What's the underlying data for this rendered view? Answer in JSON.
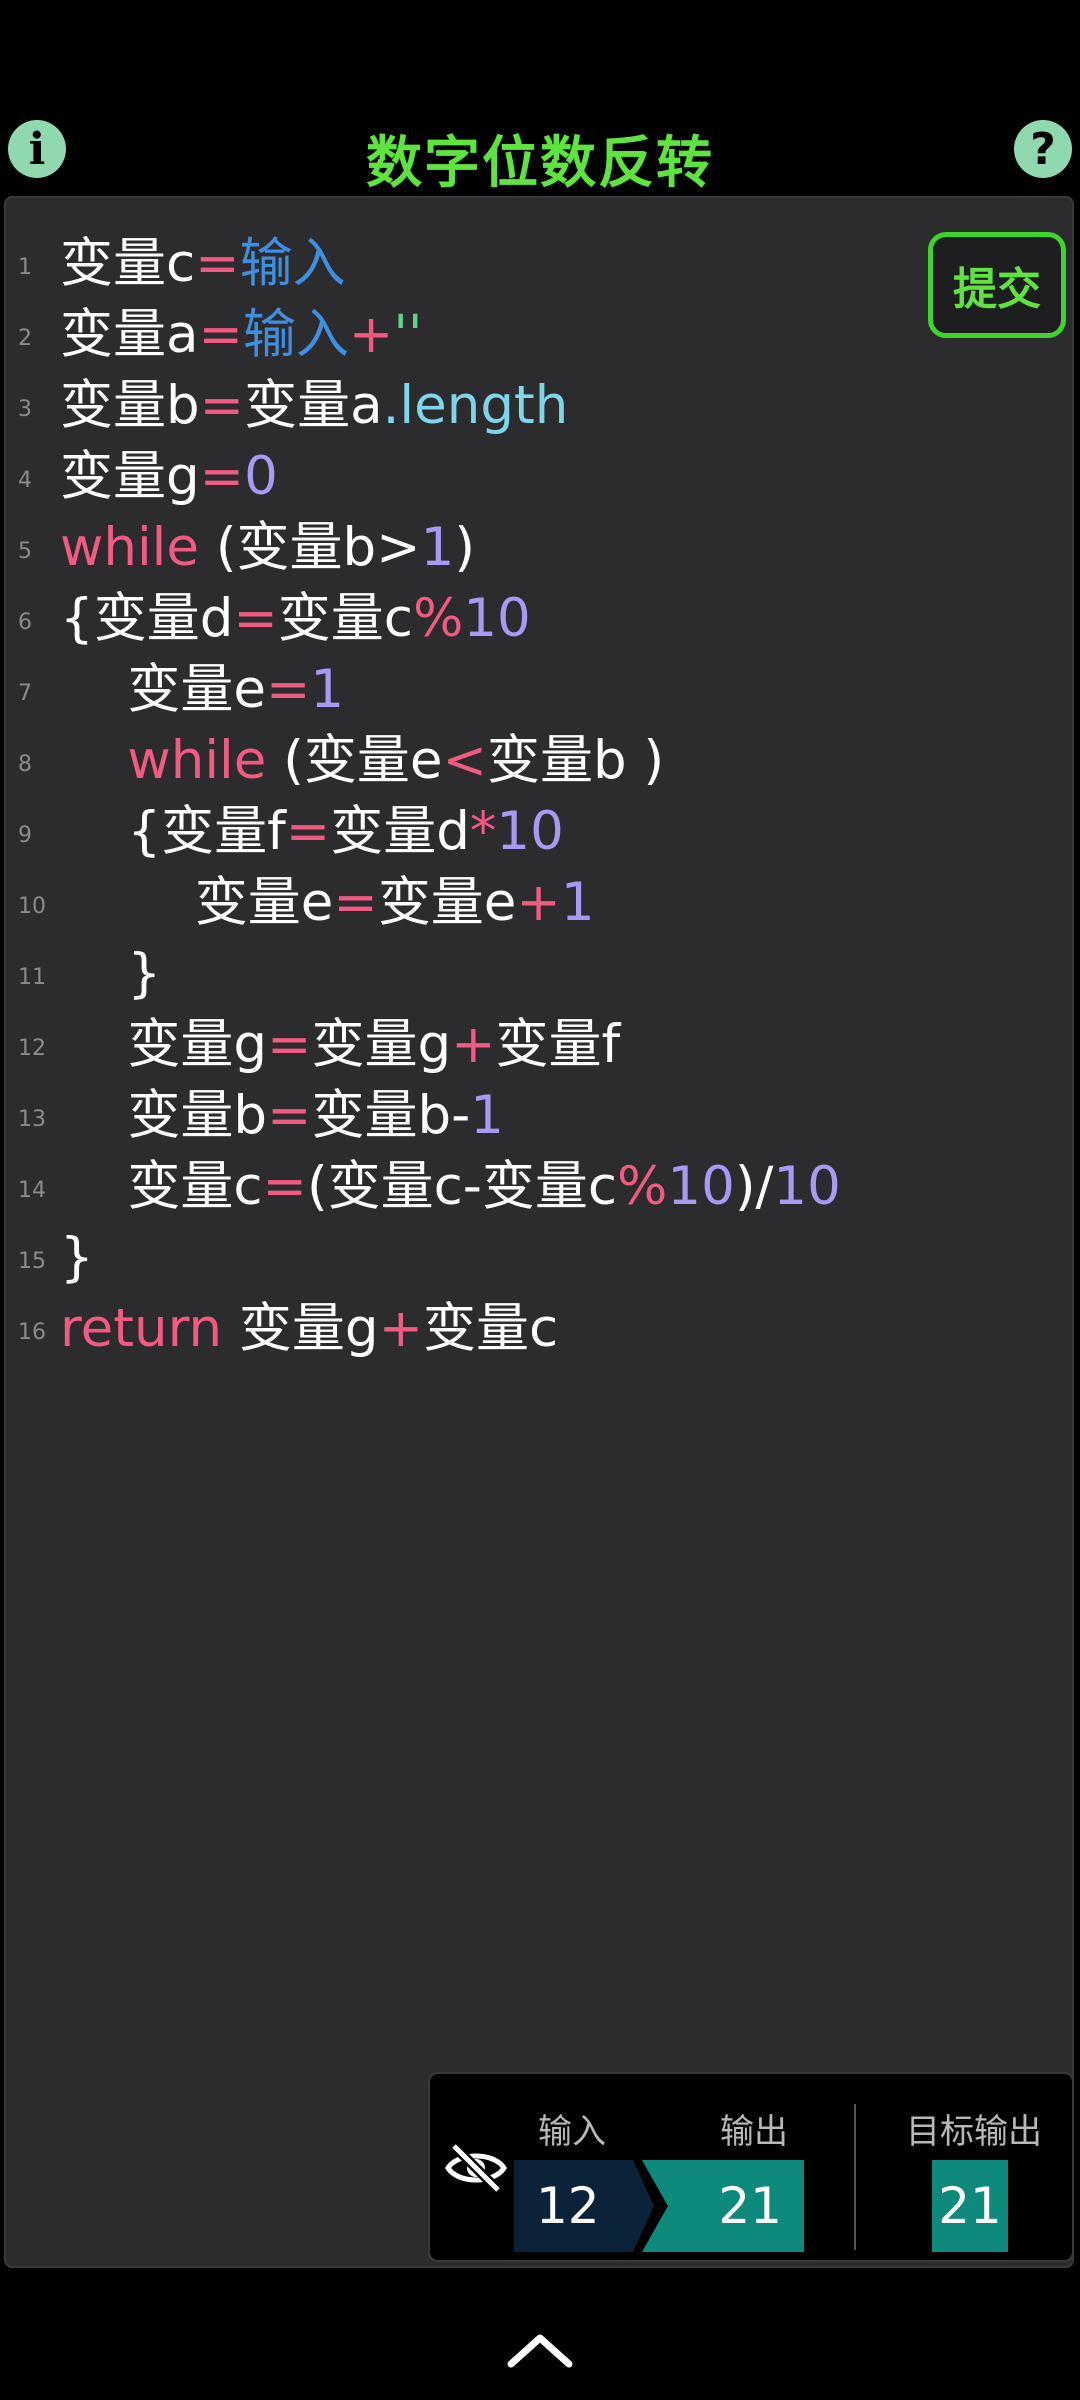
{
  "header": {
    "title": "数字位数反转",
    "info_icon_label": "i",
    "help_icon_label": "?"
  },
  "editor": {
    "submit_label": "提交",
    "lines": [
      {
        "n": "1",
        "tokens": [
          {
            "t": "变量c",
            "c": ""
          },
          {
            "t": "=",
            "c": "op"
          },
          {
            "t": "输入",
            "c": "fn"
          }
        ]
      },
      {
        "n": "2",
        "tokens": [
          {
            "t": "变量a",
            "c": ""
          },
          {
            "t": "=",
            "c": "op"
          },
          {
            "t": "输入",
            "c": "fn"
          },
          {
            "t": "+",
            "c": "op"
          },
          {
            "t": "''",
            "c": "str"
          }
        ]
      },
      {
        "n": "3",
        "tokens": [
          {
            "t": "变量b",
            "c": ""
          },
          {
            "t": "=",
            "c": "op"
          },
          {
            "t": "变量a",
            "c": ""
          },
          {
            "t": ".length",
            "c": "prop"
          }
        ]
      },
      {
        "n": "4",
        "tokens": [
          {
            "t": "变量g",
            "c": ""
          },
          {
            "t": "=",
            "c": "op"
          },
          {
            "t": "0",
            "c": "num"
          }
        ]
      },
      {
        "n": "5",
        "tokens": [
          {
            "t": "while",
            "c": "kw"
          },
          {
            "t": " (变量b>",
            "c": ""
          },
          {
            "t": "1",
            "c": "num"
          },
          {
            "t": ")",
            "c": ""
          }
        ]
      },
      {
        "n": "6",
        "tokens": [
          {
            "t": "{变量d",
            "c": ""
          },
          {
            "t": "=",
            "c": "op"
          },
          {
            "t": "变量c",
            "c": ""
          },
          {
            "t": "%",
            "c": "op"
          },
          {
            "t": "10",
            "c": "num"
          }
        ]
      },
      {
        "n": "7",
        "tokens": [
          {
            "t": "    变量e",
            "c": ""
          },
          {
            "t": "=",
            "c": "op"
          },
          {
            "t": "1",
            "c": "num"
          }
        ]
      },
      {
        "n": "8",
        "tokens": [
          {
            "t": "    ",
            "c": ""
          },
          {
            "t": "while",
            "c": "kw"
          },
          {
            "t": " (变量e",
            "c": ""
          },
          {
            "t": "<",
            "c": "op"
          },
          {
            "t": "变量b )",
            "c": ""
          }
        ]
      },
      {
        "n": "9",
        "tokens": [
          {
            "t": "    {变量f",
            "c": ""
          },
          {
            "t": "=",
            "c": "op"
          },
          {
            "t": "变量d",
            "c": ""
          },
          {
            "t": "*",
            "c": "op"
          },
          {
            "t": "10",
            "c": "num"
          }
        ]
      },
      {
        "n": "10",
        "tokens": [
          {
            "t": "        变量e",
            "c": ""
          },
          {
            "t": "=",
            "c": "op"
          },
          {
            "t": "变量e",
            "c": ""
          },
          {
            "t": "+",
            "c": "op"
          },
          {
            "t": "1",
            "c": "num"
          }
        ]
      },
      {
        "n": "11",
        "tokens": [
          {
            "t": "    }",
            "c": ""
          }
        ]
      },
      {
        "n": "12",
        "tokens": [
          {
            "t": "    变量g",
            "c": ""
          },
          {
            "t": "=",
            "c": "op"
          },
          {
            "t": "变量g",
            "c": ""
          },
          {
            "t": "+",
            "c": "op"
          },
          {
            "t": "变量f",
            "c": ""
          }
        ]
      },
      {
        "n": "13",
        "tokens": [
          {
            "t": "    变量b",
            "c": ""
          },
          {
            "t": "=",
            "c": "op"
          },
          {
            "t": "变量b-",
            "c": ""
          },
          {
            "t": "1",
            "c": "num"
          }
        ]
      },
      {
        "n": "14",
        "tokens": [
          {
            "t": "    变量c",
            "c": ""
          },
          {
            "t": "=",
            "c": "op"
          },
          {
            "t": "(变量c-变量c",
            "c": ""
          },
          {
            "t": "%",
            "c": "op"
          },
          {
            "t": "10",
            "c": "num"
          },
          {
            "t": ")/",
            "c": ""
          },
          {
            "t": "10",
            "c": "num"
          }
        ]
      },
      {
        "n": "15",
        "tokens": [
          {
            "t": "}",
            "c": ""
          }
        ]
      },
      {
        "n": "16",
        "tokens": [
          {
            "t": "return",
            "c": "kw"
          },
          {
            "t": " 变量g",
            "c": ""
          },
          {
            "t": "+",
            "c": "op"
          },
          {
            "t": "变量c",
            "c": ""
          }
        ]
      }
    ]
  },
  "io": {
    "input_label": "输入",
    "output_label": "输出",
    "target_label": "目标输出",
    "input_value": "12",
    "output_value": "21",
    "target_value": "21"
  },
  "icons": {
    "visibility_icon": "eye-off-icon",
    "expand_icon": "chevron-up-icon"
  },
  "colors": {
    "title": "#5fe33e",
    "keyword": "#f25a82",
    "number": "#a79af2",
    "builtin": "#3e8fe0",
    "property": "#7fd5ea"
  }
}
